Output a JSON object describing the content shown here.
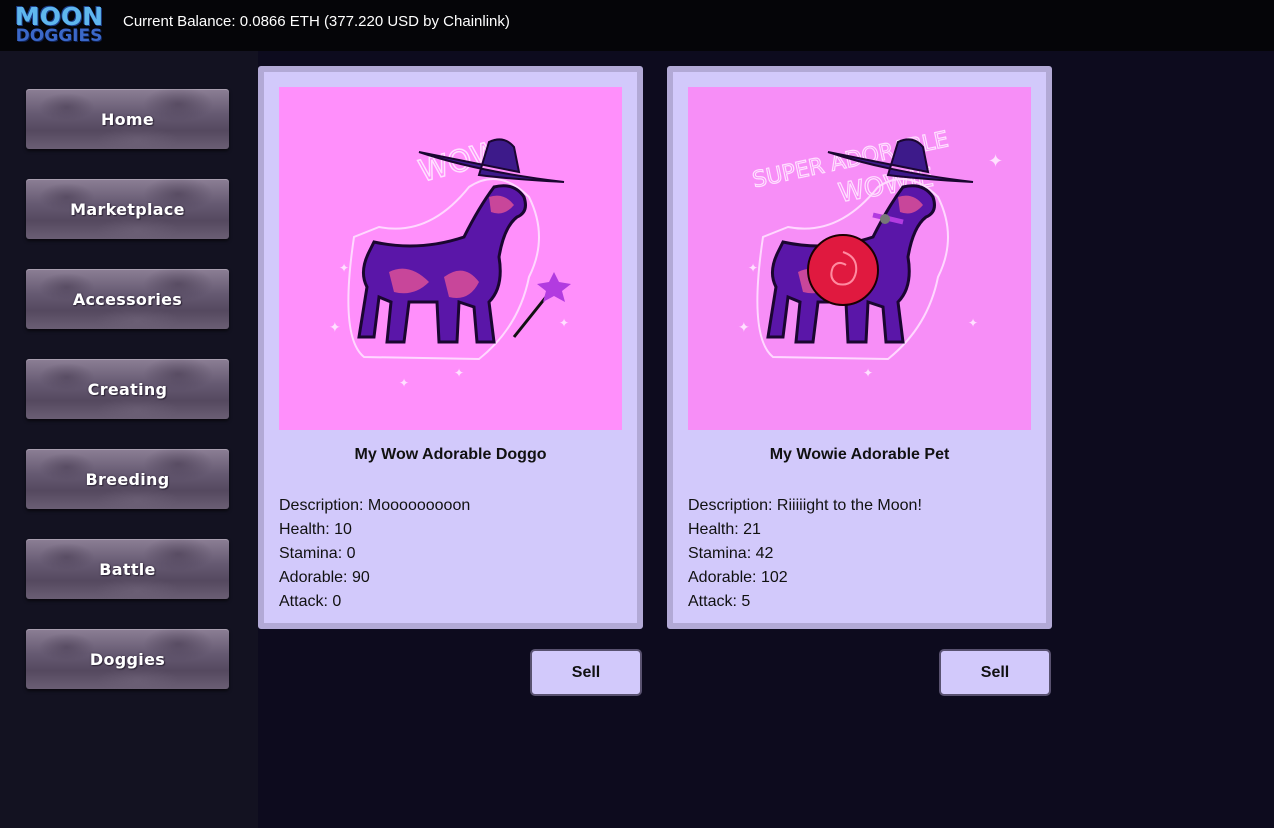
{
  "header": {
    "logo_line1": "MOON",
    "logo_line2": "DOGGIES",
    "balance": "Current Balance: 0.0866 ETH (377.220 USD by Chainlink)"
  },
  "sidebar": {
    "items": [
      {
        "label": "Home"
      },
      {
        "label": "Marketplace"
      },
      {
        "label": "Accessories"
      },
      {
        "label": "Creating"
      },
      {
        "label": "Breeding"
      },
      {
        "label": "Battle"
      },
      {
        "label": "Doggies"
      }
    ]
  },
  "cards": [
    {
      "name": "My Wow Adorable Doggo",
      "description": "Description: Mooooooooon",
      "health": "Health: 10",
      "stamina": "Stamina: 0",
      "adorable": "Adorable: 90",
      "attack": "Attack: 0",
      "image_text": "WOW",
      "sell_label": "Sell"
    },
    {
      "name": "My Wowie Adorable Pet",
      "description": "Description: Riiiiight to the Moon!",
      "health": "Health: 21",
      "stamina": "Stamina: 42",
      "adorable": "Adorable: 102",
      "attack": "Attack: 5",
      "image_text_top": "SUPER ADORABLE",
      "image_text": "WOWIE",
      "sell_label": "Sell"
    }
  ],
  "colors": {
    "card_bg": "#d2c9fb",
    "card_border": "#b2a9d6",
    "image_bg": "#ff8ffb",
    "page_bg": "#0d0b1e"
  }
}
